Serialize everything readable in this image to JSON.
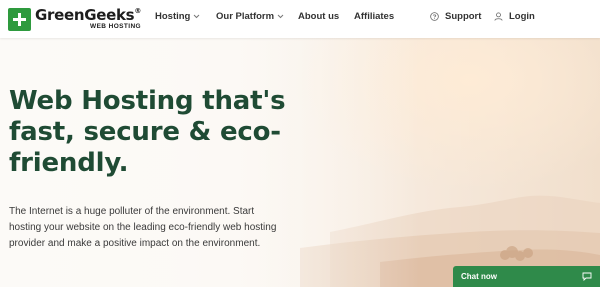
{
  "brand": {
    "name": "GreenGeeks",
    "registered": "®",
    "sub": "WEB HOSTING",
    "color": "#2e9a3e"
  },
  "nav": {
    "hosting": "Hosting",
    "platform": "Our Platform",
    "about": "About us",
    "affiliates": "Affiliates",
    "support": "Support",
    "login": "Login"
  },
  "hero": {
    "title": "Web Hosting that's fast, secure & eco-friendly.",
    "description": "The Internet is a huge polluter of the environment. Start hosting your website on the leading eco-friendly web hosting provider and make a positive impact on the environment.",
    "title_color": "#1f4b34"
  },
  "chat": {
    "label": "Chat now",
    "color": "#2f8a4a"
  },
  "icons": {
    "logo": "plus-icon",
    "support": "question-circle-icon",
    "login": "user-icon",
    "chat": "speech-bubble-icon",
    "dropdown": "chevron-down-icon"
  }
}
